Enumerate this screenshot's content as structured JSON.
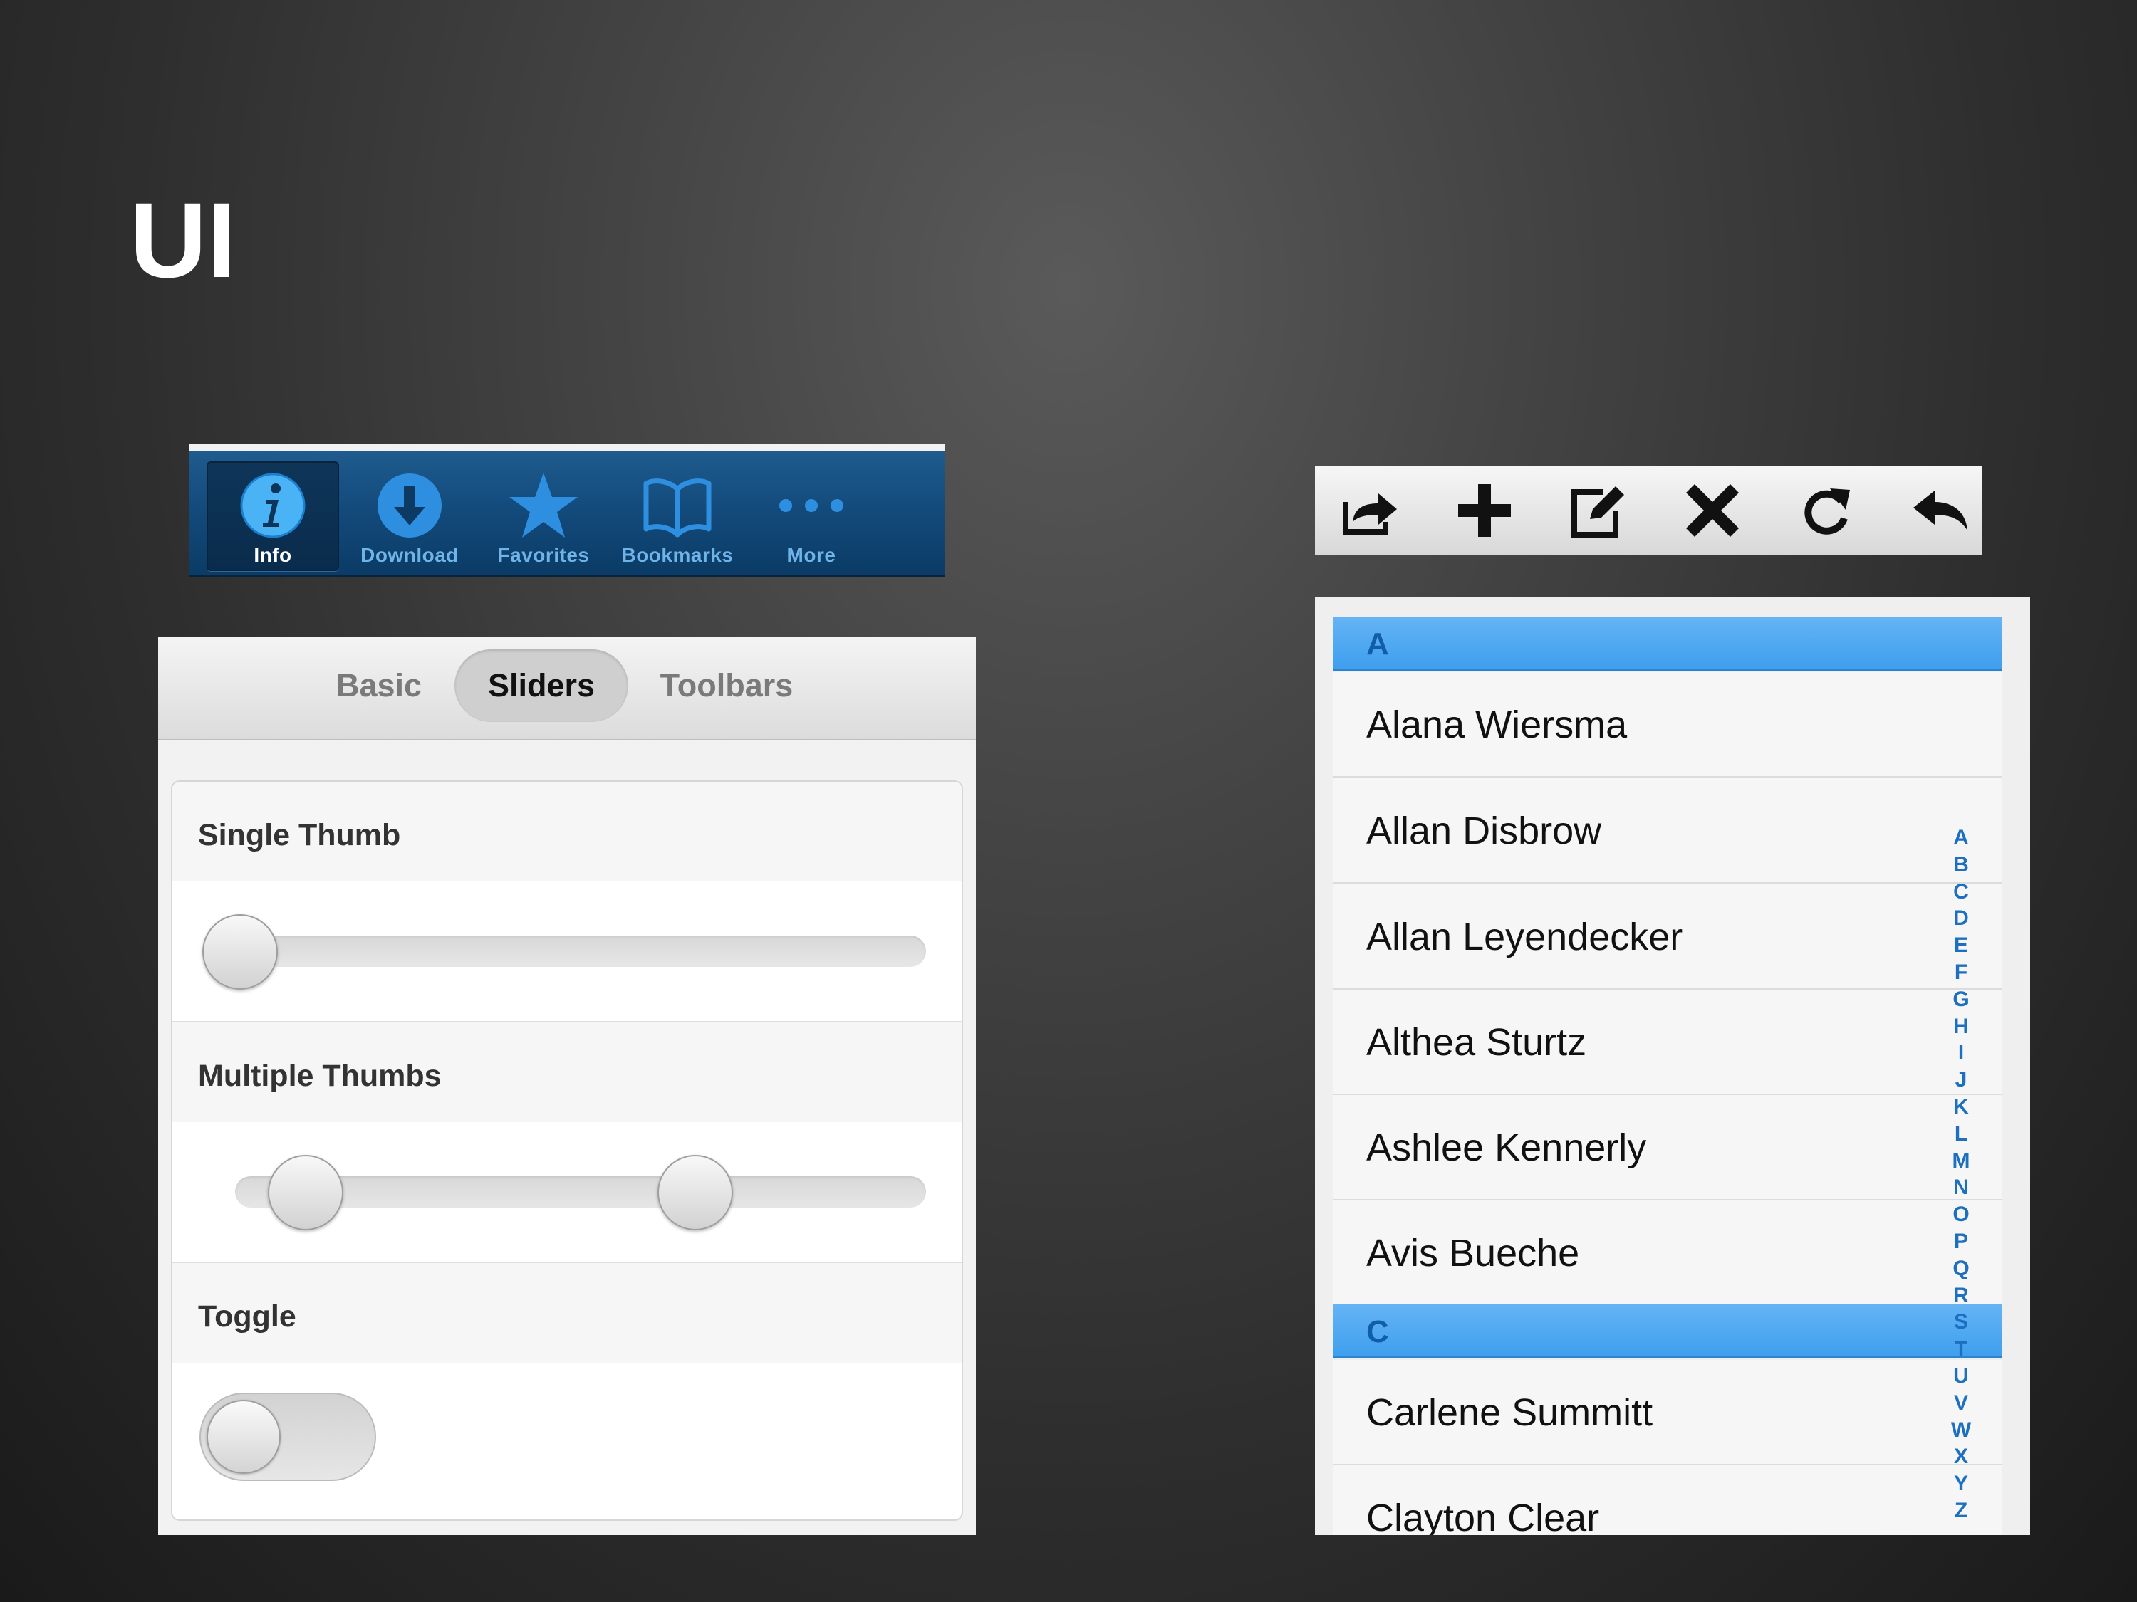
{
  "slide": {
    "title": "UI"
  },
  "tabbar": {
    "tabs": [
      {
        "label": "Info",
        "icon": "info-icon",
        "active": true
      },
      {
        "label": "Download",
        "icon": "download-icon",
        "active": false
      },
      {
        "label": "Favorites",
        "icon": "star-icon",
        "active": false
      },
      {
        "label": "Bookmarks",
        "icon": "book-icon",
        "active": false
      },
      {
        "label": "More",
        "icon": "more-dots-icon",
        "active": false
      }
    ],
    "colors": {
      "bar": "#134b7c",
      "icon": "#2e8fe0",
      "active_label": "#ffffff"
    }
  },
  "sliders_panel": {
    "segments": [
      {
        "label": "Basic",
        "active": false
      },
      {
        "label": "Sliders",
        "active": true
      },
      {
        "label": "Toolbars",
        "active": false
      }
    ],
    "fields": {
      "single": {
        "label": "Single Thumb",
        "value_fraction": 0.0
      },
      "multiple": {
        "label": "Multiple Thumbs",
        "values_fraction": [
          0.1,
          0.7
        ]
      },
      "toggle": {
        "label": "Toggle",
        "on": false
      }
    }
  },
  "toolbar": {
    "buttons": [
      {
        "icon": "share-icon"
      },
      {
        "icon": "add-icon"
      },
      {
        "icon": "compose-icon"
      },
      {
        "icon": "delete-icon"
      },
      {
        "icon": "refresh-icon"
      },
      {
        "icon": "reply-icon"
      }
    ]
  },
  "list": {
    "groups": [
      {
        "header": "A",
        "items": [
          "Alana Wiersma",
          "Allan Disbrow",
          "Allan Leyendecker",
          "Althea Sturtz",
          "Ashlee Kennerly",
          "Avis Bueche"
        ]
      },
      {
        "header": "C",
        "items": [
          "Carlene Summitt",
          "Clayton Clear"
        ]
      }
    ],
    "index_letters": [
      "A",
      "B",
      "C",
      "D",
      "E",
      "F",
      "G",
      "H",
      "I",
      "J",
      "K",
      "L",
      "M",
      "N",
      "O",
      "P",
      "Q",
      "R",
      "S",
      "T",
      "U",
      "V",
      "W",
      "X",
      "Y",
      "Z"
    ],
    "colors": {
      "header": "#4aa7f0",
      "header_text": "#115ea8",
      "index": "#1d6fc0"
    }
  }
}
